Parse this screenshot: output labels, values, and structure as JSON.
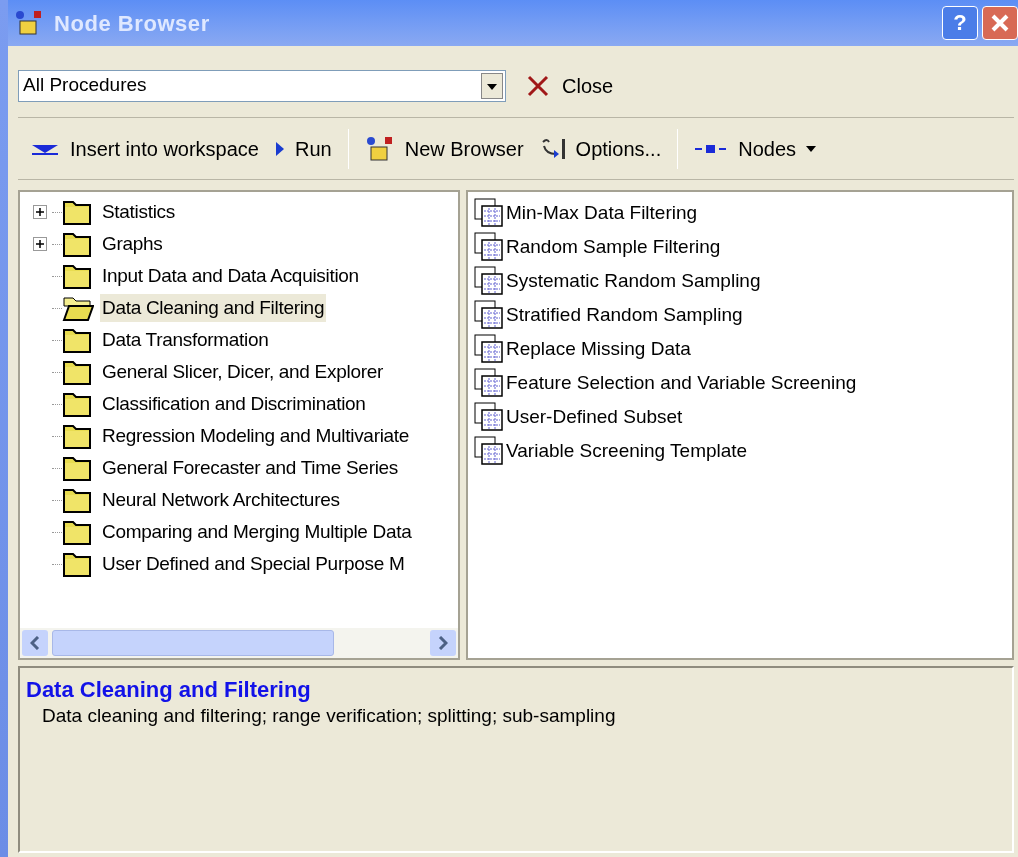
{
  "window": {
    "title": "Node Browser",
    "help_label": "?"
  },
  "filter": {
    "value": "All Procedures"
  },
  "close_button": {
    "label": "Close"
  },
  "toolbar": [
    {
      "kind": "insert",
      "label": "Insert into workspace"
    },
    {
      "kind": "run",
      "label": "Run"
    },
    {
      "kind": "separator"
    },
    {
      "kind": "new",
      "label": "New Browser"
    },
    {
      "kind": "options",
      "label": "Options..."
    },
    {
      "kind": "separator"
    },
    {
      "kind": "nodes",
      "label": "Nodes"
    }
  ],
  "tree": [
    {
      "label": "Statistics",
      "expandable": true,
      "selected": false
    },
    {
      "label": "Graphs",
      "expandable": true,
      "selected": false
    },
    {
      "label": "Input Data and Data Acquisition",
      "expandable": false,
      "selected": false
    },
    {
      "label": "Data Cleaning and Filtering",
      "expandable": false,
      "selected": true
    },
    {
      "label": "Data Transformation",
      "expandable": false,
      "selected": false
    },
    {
      "label": "General Slicer, Dicer, and Explorer",
      "expandable": false,
      "selected": false
    },
    {
      "label": "Classification and Discrimination",
      "expandable": false,
      "selected": false
    },
    {
      "label": "Regression Modeling and Multivariate",
      "expandable": false,
      "selected": false
    },
    {
      "label": "General Forecaster and Time Series",
      "expandable": false,
      "selected": false
    },
    {
      "label": "Neural Network Architectures",
      "expandable": false,
      "selected": false
    },
    {
      "label": "Comparing and Merging Multiple Data",
      "expandable": false,
      "selected": false
    },
    {
      "label": "User Defined and Special Purpose M",
      "expandable": false,
      "selected": false
    }
  ],
  "nodes": [
    "Min-Max Data Filtering",
    "Random Sample Filtering",
    "Systematic Random Sampling",
    "Stratified Random Sampling",
    "Replace Missing Data",
    "Feature Selection and Variable Screening",
    "User-Defined Subset",
    "Variable Screening Template"
  ],
  "description": {
    "title": "Data Cleaning and Filtering",
    "text": "Data cleaning and filtering; range verification; splitting; sub-sampling"
  }
}
